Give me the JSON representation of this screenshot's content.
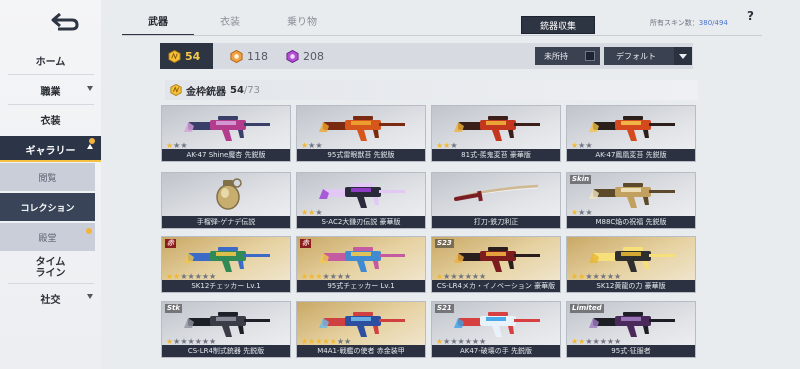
{
  "sidebar": {
    "back_icon": "back-arrow-icon",
    "items": [
      {
        "label": "ホーム",
        "key": "home"
      },
      {
        "label": "職業",
        "key": "profession"
      },
      {
        "label": "衣装",
        "key": "costume"
      },
      {
        "label": "ギャラリー",
        "key": "gallery"
      },
      {
        "label": "閲覧",
        "key": "browse"
      },
      {
        "label": "コレクション",
        "key": "collection"
      },
      {
        "label": "殿堂",
        "key": "hall"
      },
      {
        "label": "タイム\nライン",
        "key": "timeline"
      },
      {
        "label": "社交",
        "key": "social"
      }
    ]
  },
  "tabs": [
    {
      "label": "武器"
    },
    {
      "label": "衣装"
    },
    {
      "label": "乗り物"
    }
  ],
  "header": {
    "collect_label": "銃器収集",
    "owned_prefix": "所有スキン数：",
    "owned_count": "380/494",
    "help_label": "?"
  },
  "filters": {
    "gold_count": "54",
    "orange_count": "118",
    "purple_count": "208",
    "unowned_label": "未所持",
    "sort_value": "デフォルト"
  },
  "section": {
    "title": "金枠銃器",
    "owned": "54",
    "total": "/73"
  },
  "colors": {
    "accent_gold": "#f6c94a",
    "dark_panel": "#2d3442",
    "star_on": "#f0b731"
  },
  "cards": [
    {
      "caption": "AK-47 Shine魔杏 先鋭版",
      "stars": 1,
      "max": 3,
      "bg": "gray",
      "tag": "",
      "colors": [
        "#b43c8c",
        "#d7a0d8",
        "#3a3f6a"
      ]
    },
    {
      "caption": "95式雷眼獣苔 先鋭版",
      "stars": 1,
      "max": 3,
      "bg": "gray",
      "tag": "",
      "colors": [
        "#d6571c",
        "#f0a530",
        "#7a2a10"
      ]
    },
    {
      "caption": "81式-羨鬼変苔 豪華版",
      "stars": 2,
      "max": 3,
      "bg": "gray",
      "tag": "",
      "colors": [
        "#c2371e",
        "#efb13a",
        "#3b1f18"
      ]
    },
    {
      "caption": "AK-47鳳凰変苔 先鋭版",
      "stars": 1,
      "max": 3,
      "bg": "gray",
      "tag": "",
      "colors": [
        "#d44a1e",
        "#f2c24a",
        "#2a1f1a"
      ]
    },
    {
      "caption": "手榴弾-ゲナデ伝説",
      "stars": 0,
      "max": 0,
      "bg": "gray",
      "tag": "",
      "colors": [
        "#c7ae6e",
        "#f1e2b8",
        "#807048"
      ]
    },
    {
      "caption": "S-AC2大鎌刃伝説 豪華版",
      "stars": 2,
      "max": 3,
      "bg": "gray",
      "tag": "",
      "colors": [
        "#2b2a3a",
        "#9a3dd6",
        "#e2c9f5"
      ]
    },
    {
      "caption": "打刀-鉄刀利正",
      "stars": 0,
      "max": 0,
      "bg": "gray",
      "tag": "",
      "colors": [
        "#7a1d24",
        "#d0b890",
        "#3a1616"
      ]
    },
    {
      "caption": "M88C焔の祝福 先鋭版",
      "stars": 1,
      "max": 3,
      "bg": "gray",
      "tag": "Skin",
      "colors": [
        "#c2a060",
        "#f0e3c0",
        "#5c4a2a"
      ]
    },
    {
      "caption": "SK12チェッカー Lv.1",
      "stars": 2,
      "max": 7,
      "bg": "gold",
      "tag": "赤",
      "colors": [
        "#2f8a56",
        "#f0c44a",
        "#3b6ac7"
      ]
    },
    {
      "caption": "95式チェッカー Lv.1",
      "stars": 3,
      "max": 7,
      "bg": "gold",
      "tag": "赤",
      "colors": [
        "#3f8ad0",
        "#f2c84e",
        "#c45aa0"
      ]
    },
    {
      "caption": "CS-LR4メカ・イノベーション 豪華版",
      "stars": 1,
      "max": 7,
      "bg": "gold",
      "tag": "S23",
      "colors": [
        "#7c1c1c",
        "#f0b040",
        "#2a1d1d"
      ]
    },
    {
      "caption": "SK12黄龍の力 豪華版",
      "stars": 2,
      "max": 7,
      "bg": "gold",
      "tag": "",
      "colors": [
        "#2e2e2e",
        "#e7b531",
        "#f7e07a"
      ]
    },
    {
      "caption": "CS-LR4制式銃器 先鋭版",
      "stars": 1,
      "max": 7,
      "bg": "gray",
      "tag": "Stk",
      "colors": [
        "#3a3d46",
        "#8f94a0",
        "#1e2028"
      ]
    },
    {
      "caption": "M4A1-戦艦の使者 赤金装甲",
      "stars": 5,
      "max": 7,
      "bg": "gold",
      "tag": "",
      "colors": [
        "#2c4fa0",
        "#6fb9e6",
        "#d04040"
      ]
    },
    {
      "caption": "AK47-破壊の手 先鋭版",
      "stars": 1,
      "max": 7,
      "bg": "gray",
      "tag": "S21",
      "colors": [
        "#e8f2fa",
        "#3aa2e8",
        "#d64040"
      ]
    },
    {
      "caption": "95式-征服者",
      "stars": 2,
      "max": 7,
      "bg": "gray",
      "tag": "Limited",
      "colors": [
        "#4a2a5a",
        "#a07ac0",
        "#1e1e26"
      ]
    }
  ]
}
